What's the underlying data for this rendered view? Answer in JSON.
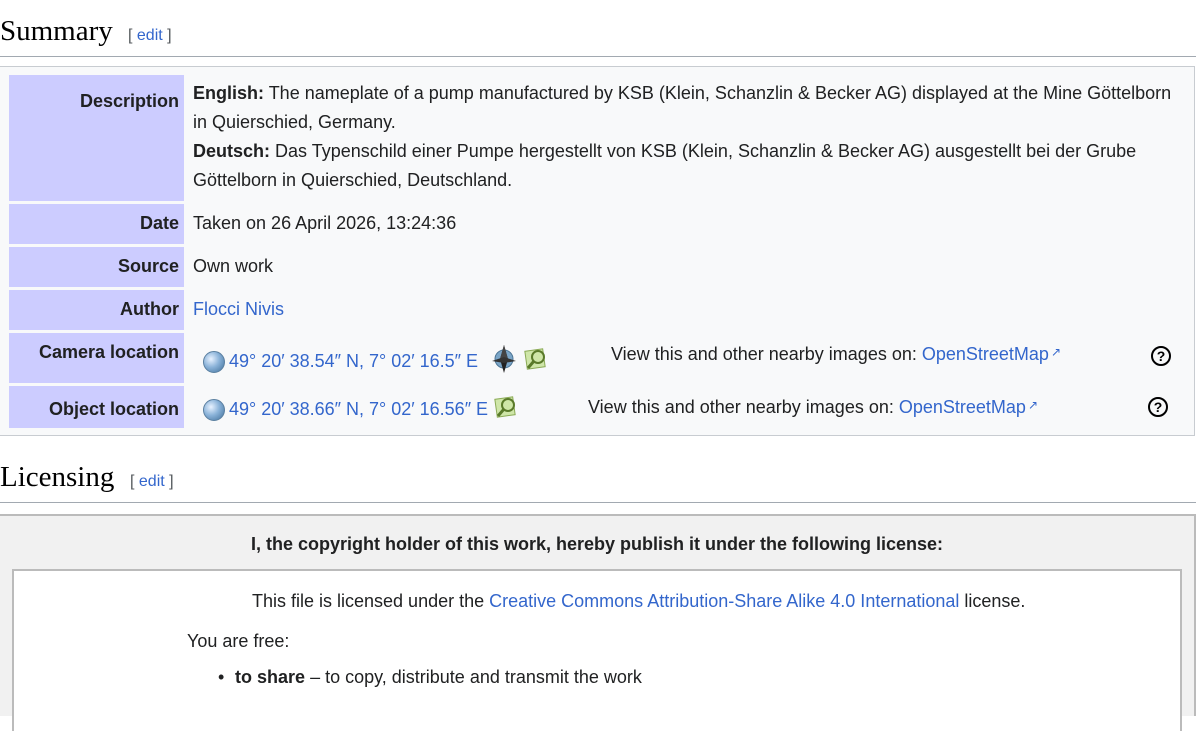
{
  "summary": {
    "title": "Summary",
    "edit": "edit"
  },
  "info": {
    "description": {
      "label": "Description",
      "english_label": "English:",
      "english_text": "The nameplate of a pump manufactured by KSB (Klein, Schanzlin & Becker AG) displayed at the Mine Göttelborn in Quierschied, Germany.",
      "deutsch_label": "Deutsch:",
      "deutsch_text": "Das Typenschild einer Pumpe hergestellt von KSB (Klein, Schanzlin & Becker AG) ausgestellt bei der Grube Göttelborn in Quierschied, Deutschland."
    },
    "date": {
      "label": "Date",
      "value": "Taken on 26 April 2026, 13:24:36"
    },
    "source": {
      "label": "Source",
      "value": "Own work"
    },
    "author": {
      "label": "Author",
      "value": "Flocci Nivis"
    },
    "camera": {
      "label": "Camera location",
      "coords": "49° 20′ 38.54″ N, 7° 02′ 16.5″ E",
      "nearby": "View this and other nearby images on:",
      "map_link": "OpenStreetMap"
    },
    "object": {
      "label": "Object location",
      "coords": "49° 20′ 38.66″ N, 7° 02′ 16.56″ E",
      "nearby": "View this and other nearby images on:",
      "map_link": "OpenStreetMap"
    }
  },
  "licensing": {
    "title": "Licensing",
    "edit": "edit",
    "statement": "I, the copyright holder of this work, hereby publish it under the following license:",
    "license_prefix": "This file is licensed under the",
    "license_link": "Creative Commons Attribution-Share Alike 4.0 International",
    "license_suffix": "license.",
    "you_are_free": "You are free:",
    "freedoms": [
      {
        "term": "to share",
        "desc": "– to copy, distribute and transmit the work"
      }
    ]
  },
  "colors": {
    "link": "#3366cc",
    "label_bg": "#ccccff",
    "table_bg": "#f8f9fa"
  },
  "icons": [
    "globe-icon",
    "compass-icon",
    "map-icon",
    "help-icon",
    "external-link-icon"
  ]
}
